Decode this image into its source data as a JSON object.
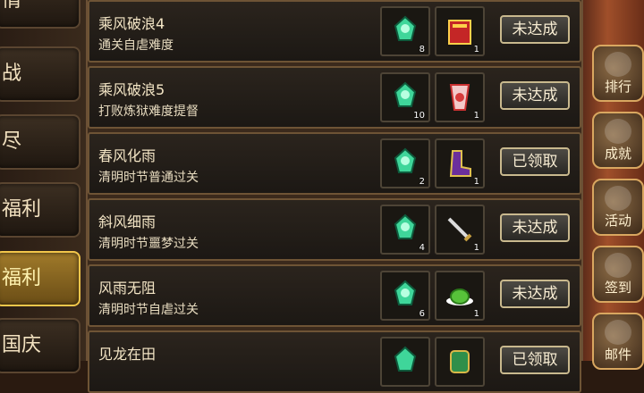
{
  "categories": [
    {
      "label": "情"
    },
    {
      "label": "战"
    },
    {
      "label": "尽"
    },
    {
      "label": "福利"
    },
    {
      "label": "福利"
    },
    {
      "label": "国庆"
    }
  ],
  "tasks": [
    {
      "title": "乘风破浪4",
      "desc": "通关自虐难度",
      "reward1_qty": "8",
      "reward2_qty": "1",
      "status": "未达成"
    },
    {
      "title": "乘风破浪5",
      "desc": "打败炼狱难度提督",
      "reward1_qty": "10",
      "reward2_qty": "1",
      "status": "未达成"
    },
    {
      "title": "春风化雨",
      "desc": "清明时节普通过关",
      "reward1_qty": "2",
      "reward2_qty": "1",
      "status": "已领取"
    },
    {
      "title": "斜风细雨",
      "desc": "清明时节噩梦过关",
      "reward1_qty": "4",
      "reward2_qty": "1",
      "status": "未达成"
    },
    {
      "title": "风雨无阻",
      "desc": "清明时节自虐过关",
      "reward1_qty": "6",
      "reward2_qty": "1",
      "status": "未达成"
    },
    {
      "title": "见龙在田",
      "desc": "",
      "reward1_qty": "",
      "reward2_qty": "",
      "status": "已领取"
    }
  ],
  "side_menu": [
    {
      "label": "排行"
    },
    {
      "label": "成就"
    },
    {
      "label": "活动"
    },
    {
      "label": "签到"
    },
    {
      "label": "邮件"
    }
  ],
  "colors": {
    "selected_tab": "#f2c64a",
    "button_border": "#c9b98e",
    "reward_green": "#3fd69a"
  }
}
